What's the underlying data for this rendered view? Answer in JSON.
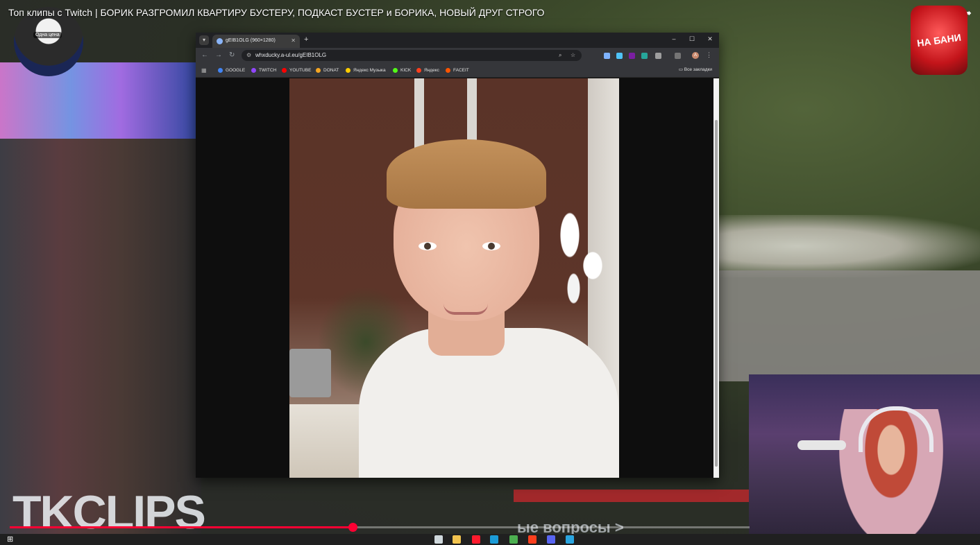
{
  "video": {
    "title": "Топ клипы с Twitch | БОРИК РАЗГРОМИЛ КВАРТИРУ БУСТЕРУ, ПОДКАСТ БУСТЕР и БОРИКА, НОВЫЙ ДРУГ СТРОГО",
    "avatar_badge": "Одна цена",
    "channel_logo": "НА БАНИ",
    "watermark": "TKCLIPS",
    "caption_fragment": "ые вопросы >",
    "progress": 0.463,
    "share_icon": "share-icon"
  },
  "browser": {
    "tab": {
      "title": "gEIB1OLG (960×1280)"
    },
    "new_tab": "+",
    "window_controls": {
      "minimize": "–",
      "maximize": "☐",
      "close": "✕"
    },
    "nav": {
      "back": "←",
      "forward": "→",
      "reload": "↻"
    },
    "url": "whxducky.a-ul.eu/gEIB1OLG",
    "bookmarks": [
      {
        "label": "GOOGLE",
        "color": "#4285f4"
      },
      {
        "label": "TWITCH",
        "color": "#9146ff"
      },
      {
        "label": "YOUTUBE",
        "color": "#ff0000"
      },
      {
        "label": "DONAT",
        "color": "#f5a623"
      },
      {
        "label": "Яндекс Музыка",
        "color": "#ffcc00"
      },
      {
        "label": "KICK",
        "color": "#53fc18"
      },
      {
        "label": "Яндекс",
        "color": "#fc3f1d"
      },
      {
        "label": "FACEIT",
        "color": "#ff5500"
      }
    ],
    "all_bookmarks": "Все закладки",
    "profile_initial": "A"
  },
  "taskbar": {
    "icons": [
      {
        "name": "file-explorer",
        "color": "#f2c44f"
      },
      {
        "name": "opera",
        "color": "#ff1b2d"
      },
      {
        "name": "steam",
        "color": "#1b9bd7"
      },
      {
        "name": "chrome",
        "color": "#4caf50"
      },
      {
        "name": "yandex",
        "color": "#fc3f1d"
      },
      {
        "name": "discord",
        "color": "#5865f2"
      },
      {
        "name": "telegram",
        "color": "#2aa5e0"
      }
    ]
  }
}
